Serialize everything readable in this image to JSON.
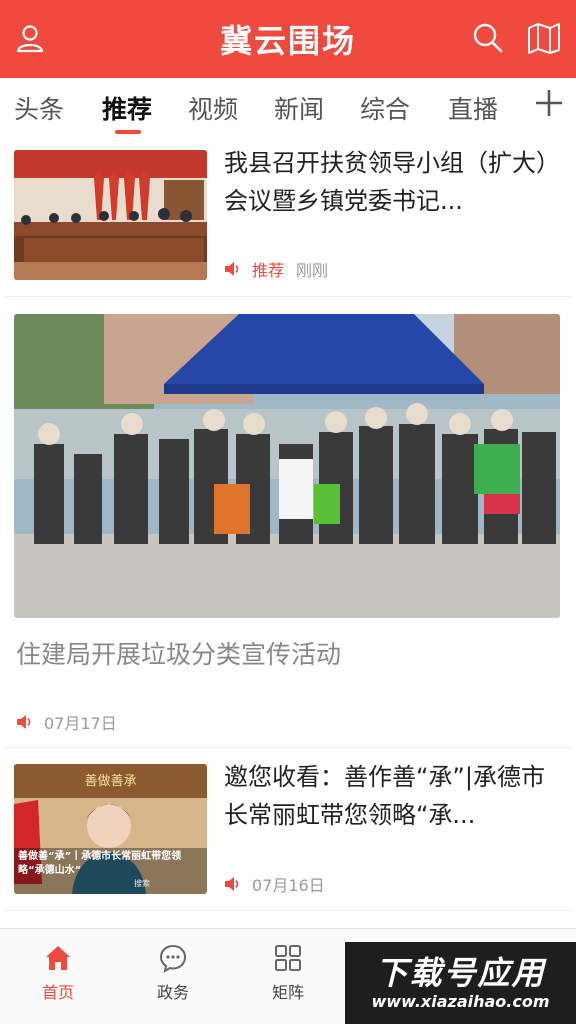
{
  "header": {
    "title": "冀云围场",
    "user_icon": "user-icon",
    "search_icon": "search-icon",
    "map_icon": "map-icon",
    "bg_color": "#f04a3e"
  },
  "tabs": {
    "items": [
      "头条",
      "推荐",
      "视频",
      "新闻",
      "综合",
      "直播"
    ],
    "active": "推荐",
    "add_icon": "plus-icon"
  },
  "news": [
    {
      "title": "我县召开扶贫领导小组（扩大）会议暨乡镇党委书记...",
      "tag": "推荐",
      "time": "刚刚",
      "thumb_icon": "meeting-photo"
    },
    {
      "title": "住建局开展垃圾分类宣传活动",
      "time": "07月17日",
      "thumb_icon": "outdoor-event-photo"
    },
    {
      "title": "邀您收看：善作善“承”|承德市长常丽虹带您领略“承...",
      "time": "07月16日",
      "thumb_icon": "video-thumbnail",
      "thumb_caption": "善做善“承”丨承德市长常丽虹带您领略“承德山水”",
      "thumb_banner": "善做善承",
      "thumb_search": "搜索"
    }
  ],
  "bottom_nav": {
    "items": [
      {
        "label": "首页",
        "icon": "home-icon"
      },
      {
        "label": "政务",
        "icon": "chat-icon"
      },
      {
        "label": "矩阵",
        "icon": "grid-icon"
      }
    ],
    "active": "首页"
  },
  "watermark": {
    "top": "下载号应用",
    "bottom": "www.xiazaihao.com"
  }
}
